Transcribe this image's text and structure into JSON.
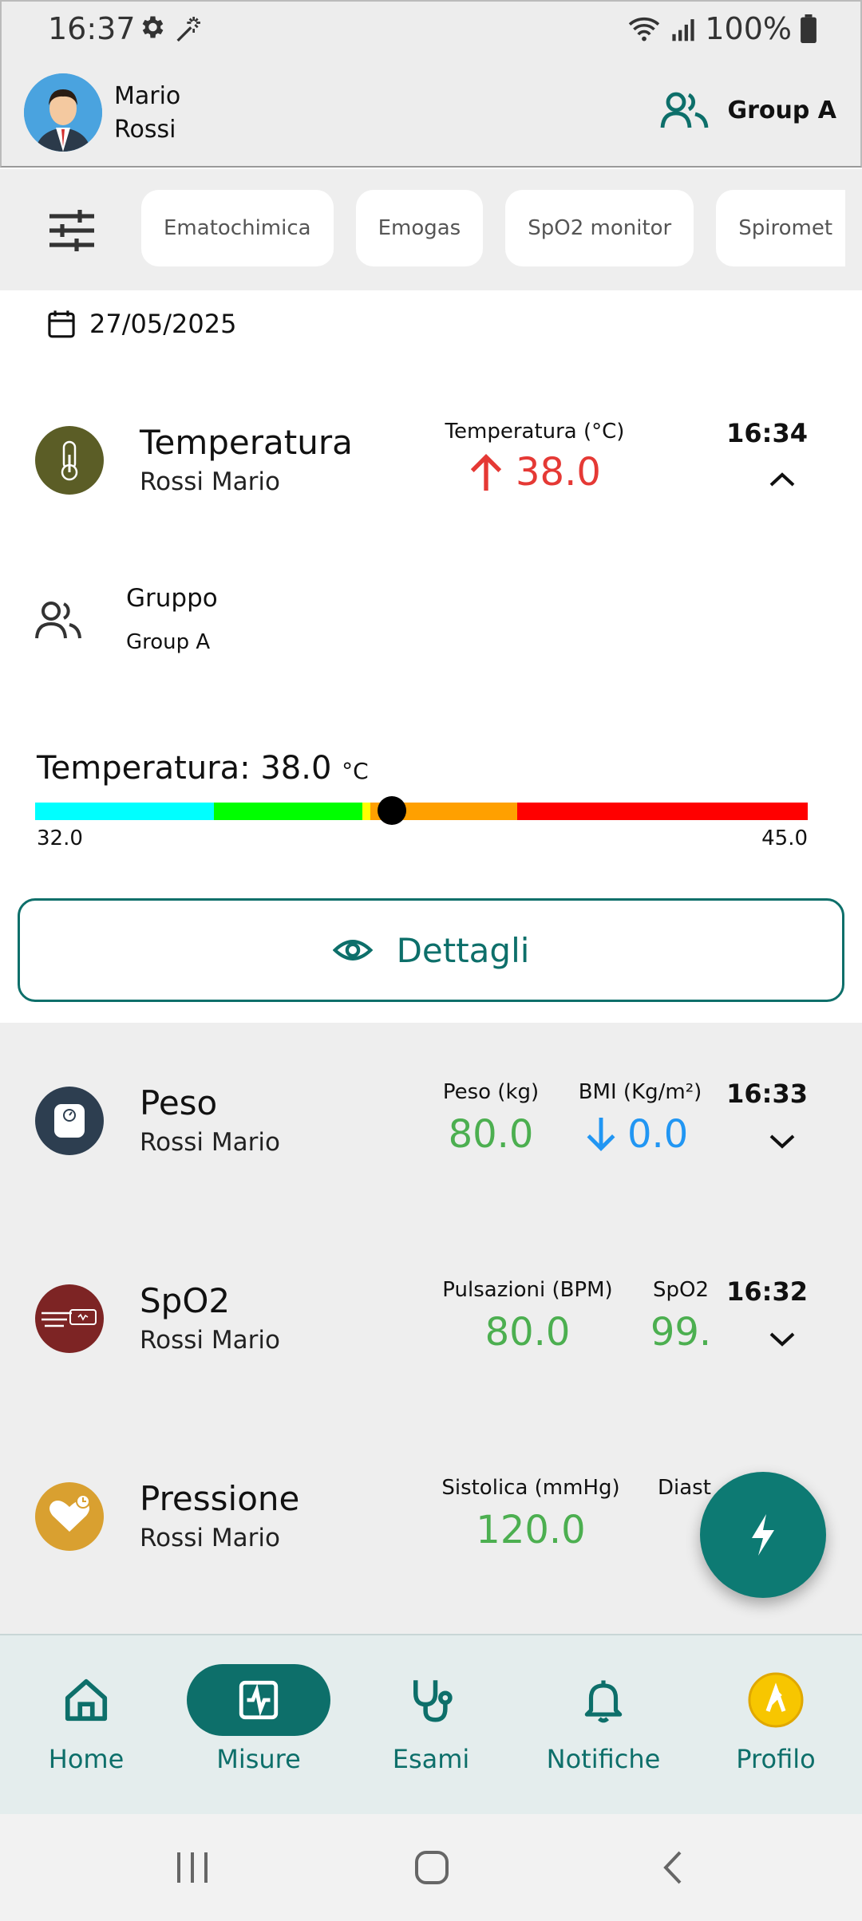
{
  "status_bar": {
    "time": "16:37",
    "battery": "100%"
  },
  "header": {
    "user_name": "Mario\nRossi",
    "group_label": "Group A"
  },
  "filters": {
    "chips": [
      "Ematochimica",
      "Emogas",
      "SpO2 monitor",
      "Spiromet"
    ]
  },
  "date": "27/05/2025",
  "temperature_card": {
    "title": "Temperatura",
    "patient": "Rossi Mario",
    "metric_label": "Temperatura (°C)",
    "metric_value": "38.0",
    "time": "16:34",
    "group_title": "Gruppo",
    "group_value": "Group A",
    "range_title": "Temperatura: 38.0",
    "range_unit": "°C",
    "range_min": "32.0",
    "range_max": "45.0",
    "marker_value": 38.0,
    "details_label": "Dettagli"
  },
  "peso_card": {
    "title": "Peso",
    "patient": "Rossi Mario",
    "label1": "Peso (kg)",
    "value1": "80.0",
    "label2": "BMI (Kg/m²)",
    "value2": "0.0",
    "time": "16:33"
  },
  "spo2_card": {
    "title": "SpO2",
    "patient": "Rossi Mario",
    "label1": "Pulsazioni (BPM)",
    "value1": "80.0",
    "label2": "SpO2",
    "value2": "99.",
    "time": "16:32"
  },
  "pressione_card": {
    "title": "Pressione",
    "patient": "Rossi Mario",
    "label1": "Sistolica (mmHg)",
    "value1": "120.0",
    "label2": "Diast"
  },
  "bottom_nav": {
    "home": "Home",
    "misure": "Misure",
    "esami": "Esami",
    "notifiche": "Notifiche",
    "profilo": "Profilo"
  },
  "colors": {
    "accent": "#0d6f6a",
    "high": "#e53935",
    "normal": "#4caf50",
    "low": "#2196f3"
  }
}
